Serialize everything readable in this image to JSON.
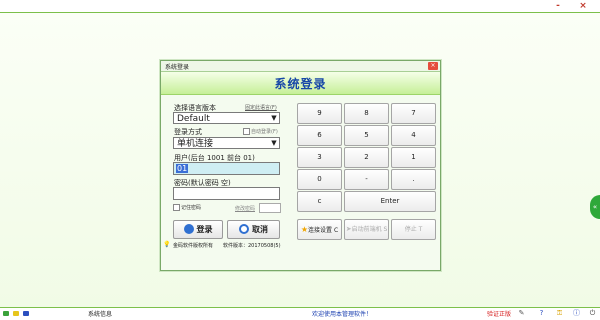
{
  "window": {
    "minimize_label": "-",
    "close_label": "×"
  },
  "side_handle": {
    "icon": "back-arrows-icon",
    "glyph": "«"
  },
  "dialog": {
    "title": "系统登录",
    "close_glyph": "×",
    "header_title": "系统登录",
    "language": {
      "label": "选择语言版本",
      "link": "固定此语言(F)",
      "value": "Default",
      "arrow": "▼"
    },
    "login_mode": {
      "label": "登录方式",
      "checkbox": "自动登录(F)",
      "value": "单机连接",
      "arrow": "▼"
    },
    "user": {
      "label": "用户(后台 1001  前台 01)",
      "value": "01"
    },
    "password": {
      "label": "密码(默认密码 空)",
      "value": ""
    },
    "remember": {
      "label": "记住密码"
    },
    "change_password": {
      "label": "修改密码"
    },
    "login_button": {
      "label": "登录",
      "icon": "user-icon"
    },
    "cancel_button": {
      "label": "取消",
      "icon": "cancel-icon"
    },
    "footer": {
      "copyright": "金码软件版权所有",
      "version": "软件版本：20170508(5)"
    },
    "keypad": {
      "keys": [
        [
          "9",
          "8",
          "7"
        ],
        [
          "6",
          "5",
          "4"
        ],
        [
          "3",
          "2",
          "1"
        ],
        [
          "0",
          "-",
          "."
        ]
      ],
      "clear": "c",
      "enter": "Enter",
      "connect": "连接设置 C",
      "start_terminal": "启动前端机 S",
      "stop": "停止 T"
    }
  },
  "statusbar": {
    "info": "系统信息",
    "welcome": "欢迎使用本管理软件！",
    "verify": "验证正版",
    "colors": {
      "green": "#3aa23a",
      "yellow": "#e6c51c",
      "blue": "#2c4fbf",
      "red": "#d62020"
    }
  }
}
